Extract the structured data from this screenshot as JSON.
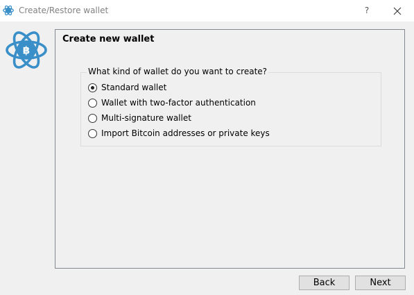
{
  "window": {
    "title": "Create/Restore wallet",
    "help_label": "?",
    "icons": {
      "app": "electrum-logo-icon",
      "close": "close-icon"
    }
  },
  "panel": {
    "title": "Create new wallet",
    "question": "What kind of wallet do you want to create?",
    "options": [
      {
        "label": "Standard wallet",
        "checked": true
      },
      {
        "label": "Wallet with two-factor authentication",
        "checked": false
      },
      {
        "label": "Multi-signature wallet",
        "checked": false
      },
      {
        "label": "Import Bitcoin addresses or private keys",
        "checked": false
      }
    ]
  },
  "buttons": {
    "back": "Back",
    "next": "Next"
  },
  "colors": {
    "logo_blue": "#3a8fc9",
    "background": "#f0f0f0"
  }
}
